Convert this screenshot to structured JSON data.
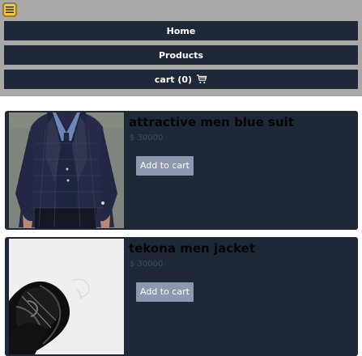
{
  "header": {
    "nav": {
      "home": "Home",
      "products": "Products",
      "cart": "cart (0)"
    }
  },
  "products": [
    {
      "title": "attractive men blue suit",
      "price": "$ 30000",
      "button": "Add to cart"
    },
    {
      "title": "tekona men jacket",
      "price": "$ 30000",
      "button": "Add to cart"
    }
  ],
  "icons": {
    "menu": "hamburger-icon",
    "cart": "shopping-cart-icon"
  },
  "colors": {
    "header": "#a8a8a8",
    "panel": "#1f2839",
    "menu": "#efc64c",
    "button": "#8c98ad"
  }
}
